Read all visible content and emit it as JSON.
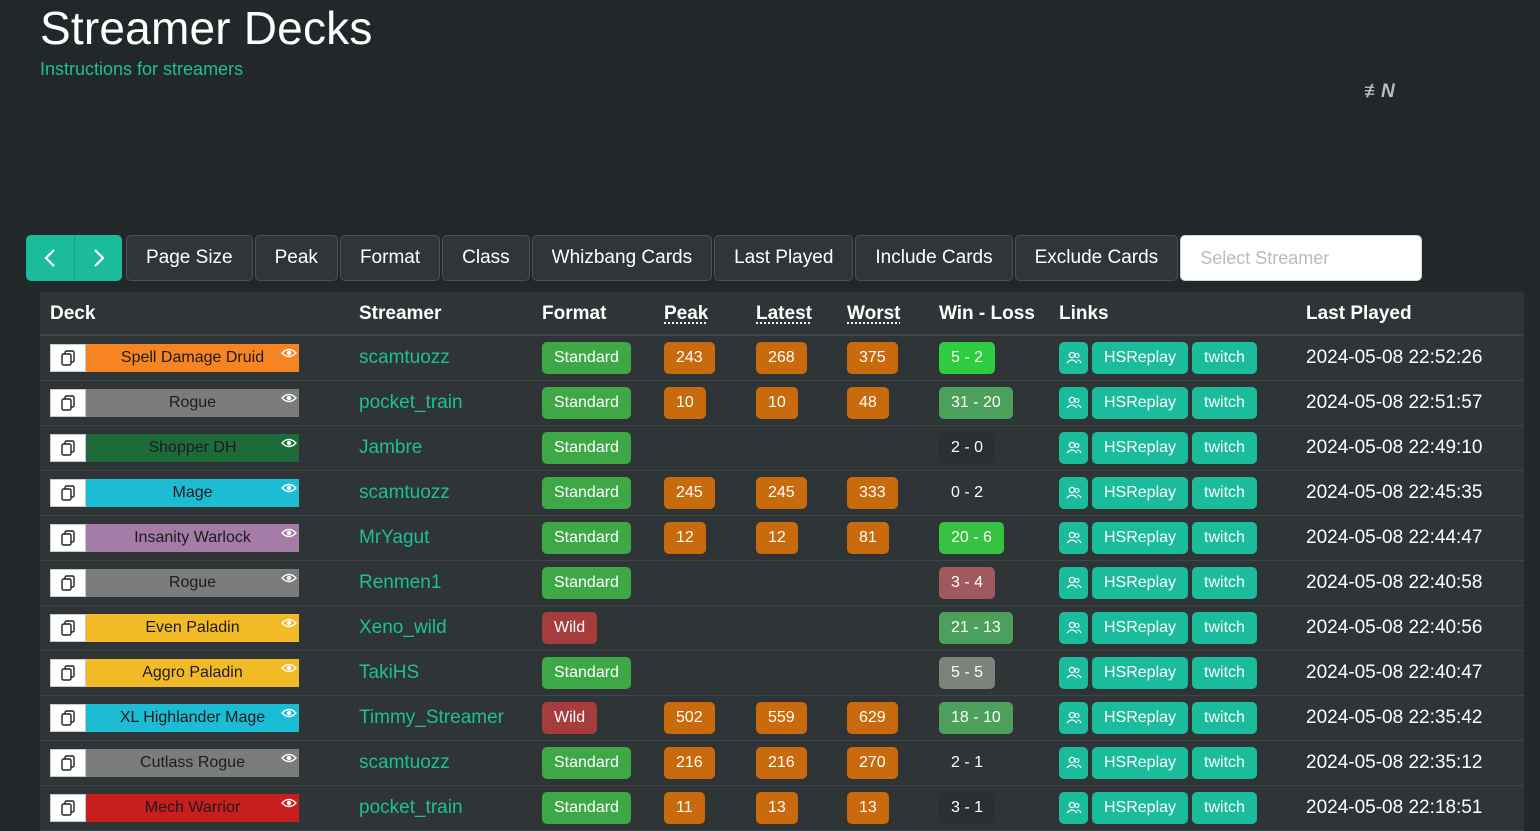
{
  "header": {
    "title": "Streamer Decks",
    "subtitle": "Instructions for streamers",
    "logo_text": "≢N"
  },
  "toolbar": {
    "prev_icon": "chevron-left-icon",
    "next_icon": "chevron-right-icon",
    "buttons": [
      "Page Size",
      "Peak",
      "Format",
      "Class",
      "Whizbang Cards",
      "Last Played",
      "Include Cards",
      "Exclude Cards"
    ],
    "select_streamer_placeholder": "Select Streamer"
  },
  "table": {
    "columns": {
      "deck": "Deck",
      "streamer": "Streamer",
      "format": "Format",
      "peak": "Peak",
      "latest": "Latest",
      "worst": "Worst",
      "win_loss": "Win - Loss",
      "links": "Links",
      "last_played": "Last Played"
    },
    "link_labels": {
      "hsreplay": "HSReplay",
      "twitch": "twitch"
    },
    "rows": [
      {
        "deck": "Spell Damage Druid",
        "deck_color": "#f68422",
        "streamer": "scamtuozz",
        "format": "Standard",
        "peak": "243",
        "latest": "268",
        "worst": "375",
        "win_loss": "5 - 2",
        "wl_color": "#2ecc40",
        "last_played": "2024-05-08 22:52:26"
      },
      {
        "deck": "Rogue",
        "deck_color": "#7c7c7c",
        "streamer": "pocket_train",
        "format": "Standard",
        "peak": "10",
        "latest": "10",
        "worst": "48",
        "win_loss": "31 - 20",
        "wl_color": "#4ca05a",
        "last_played": "2024-05-08 22:51:57"
      },
      {
        "deck": "Shopper DH",
        "deck_color": "#1e6b3a",
        "streamer": "Jambre",
        "format": "Standard",
        "peak": "",
        "latest": "",
        "worst": "",
        "win_loss": "2 - 0",
        "wl_color": "#2a3032",
        "last_played": "2024-05-08 22:49:10"
      },
      {
        "deck": "Mage",
        "deck_color": "#1bbcd4",
        "streamer": "scamtuozz",
        "format": "Standard",
        "peak": "245",
        "latest": "245",
        "worst": "333",
        "win_loss": "0 - 2",
        "wl_color": "transparent",
        "last_played": "2024-05-08 22:45:35"
      },
      {
        "deck": "Insanity Warlock",
        "deck_color": "#a57ba7",
        "streamer": "MrYagut",
        "format": "Standard",
        "peak": "12",
        "latest": "12",
        "worst": "81",
        "win_loss": "20 - 6",
        "wl_color": "#34c240",
        "last_played": "2024-05-08 22:44:47"
      },
      {
        "deck": "Rogue",
        "deck_color": "#7c7c7c",
        "streamer": "Renmen1",
        "format": "Standard",
        "peak": "",
        "latest": "",
        "worst": "",
        "win_loss": "3 - 4",
        "wl_color": "#a0595e",
        "last_played": "2024-05-08 22:40:58"
      },
      {
        "deck": "Even Paladin",
        "deck_color": "#f2ba26",
        "streamer": "Xeno_wild",
        "format": "Wild",
        "peak": "",
        "latest": "",
        "worst": "",
        "win_loss": "21 - 13",
        "wl_color": "#4ca05a",
        "last_played": "2024-05-08 22:40:56"
      },
      {
        "deck": "Aggro Paladin",
        "deck_color": "#f2ba26",
        "streamer": "TakiHS",
        "format": "Standard",
        "peak": "",
        "latest": "",
        "worst": "",
        "win_loss": "5 - 5",
        "wl_color": "#7a847c",
        "last_played": "2024-05-08 22:40:47"
      },
      {
        "deck": "XL Highlander Mage",
        "deck_color": "#1bbcd4",
        "streamer": "Timmy_Streamer",
        "format": "Wild",
        "peak": "502",
        "latest": "559",
        "worst": "629",
        "win_loss": "18 - 10",
        "wl_color": "#4ca05a",
        "last_played": "2024-05-08 22:35:42"
      },
      {
        "deck": "Cutlass Rogue",
        "deck_color": "#7c7c7c",
        "streamer": "scamtuozz",
        "format": "Standard",
        "peak": "216",
        "latest": "216",
        "worst": "270",
        "win_loss": "2 - 1",
        "wl_color": "transparent",
        "last_played": "2024-05-08 22:35:12"
      },
      {
        "deck": "Mech Warrior",
        "deck_color": "#c81e1e",
        "streamer": "pocket_train",
        "format": "Standard",
        "peak": "11",
        "latest": "13",
        "worst": "13",
        "win_loss": "3 - 1",
        "wl_color": "#2a3032",
        "last_played": "2024-05-08 22:18:51"
      }
    ]
  }
}
